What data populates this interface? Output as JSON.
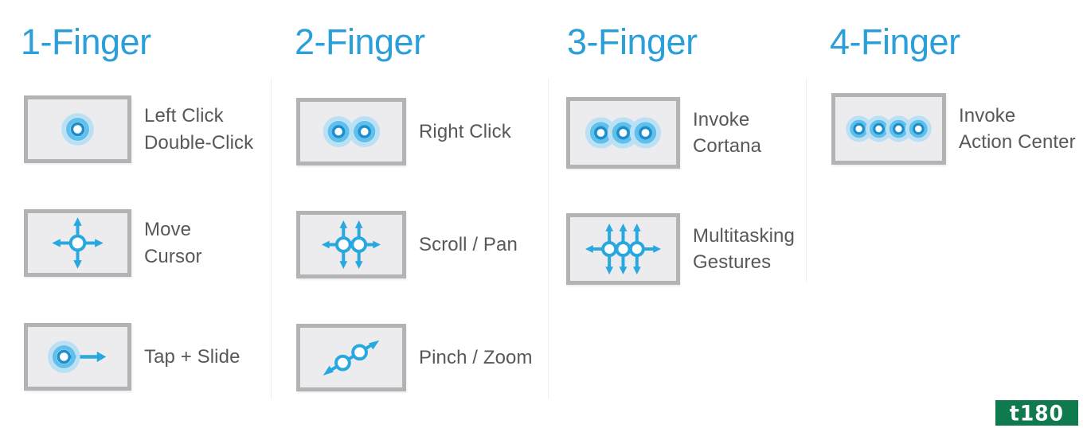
{
  "page": {
    "background": "#ffffff",
    "accent_blue": "#2b9fd8",
    "icon_blue": "#29a8e0",
    "tile_fill": "#ececee",
    "tile_border": "#b3b3b6",
    "label_color": "#58585b",
    "divider_color": "#f0f0f2"
  },
  "columns": [
    {
      "title": "1-Finger",
      "rows": [
        {
          "icon": "one-finger-tap-icon",
          "label": "Left Click\nDouble-Click"
        },
        {
          "icon": "four-way-arrow-one-circle-icon",
          "label": "Move\nCursor"
        },
        {
          "icon": "tap-and-slide-arrow-icon",
          "label": "Tap + Slide"
        }
      ]
    },
    {
      "title": "2-Finger",
      "rows": [
        {
          "icon": "two-finger-tap-icon",
          "label": "Right Click"
        },
        {
          "icon": "two-finger-scroll-arrows-icon",
          "label": "Scroll / Pan"
        },
        {
          "icon": "pinch-zoom-diagonal-arrow-icon",
          "label": "Pinch / Zoom"
        }
      ]
    },
    {
      "title": "3-Finger",
      "rows": [
        {
          "icon": "three-finger-tap-icon",
          "label": "Invoke\nCortana"
        },
        {
          "icon": "three-finger-multitask-arrows-icon",
          "label": "Multitasking\nGestures"
        }
      ]
    },
    {
      "title": "4-Finger",
      "rows": [
        {
          "icon": "four-finger-tap-icon",
          "label": "Invoke\nAction Center"
        }
      ]
    }
  ],
  "watermark": {
    "text": "t180",
    "background": "#107a4f",
    "text_color": "#ffffff"
  }
}
